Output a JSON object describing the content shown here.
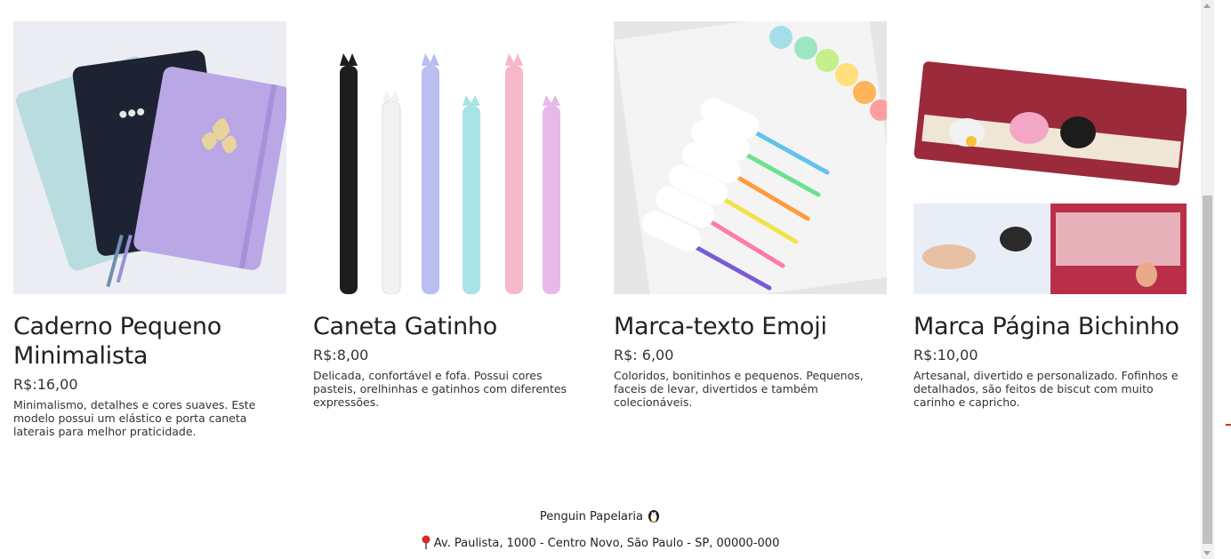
{
  "products": [
    {
      "name": "Caderno Pequeno Minimalista",
      "price": "R$:16,00",
      "description": "Minimalismo, detalhes e cores suaves. Este modelo possui um elástico e porta caneta laterais para melhor praticidade.",
      "image": "notebooks-image"
    },
    {
      "name": "Caneta Gatinho",
      "price": "R$:8,00",
      "description": "Delicada, confortável e fofa. Possui cores pasteis, orelhinhas e gatinhos com diferentes expressões.",
      "image": "cat-pens-image"
    },
    {
      "name": "Marca-texto Emoji",
      "price": "R$: 6,00",
      "description": "Coloridos, bonitinhos e pequenos. Pequenos, faceis de levar, divertidos e também colecionáveis.",
      "image": "highlighters-image"
    },
    {
      "name": "Marca Página Bichinho",
      "price": "R$:10,00",
      "description": "Artesanal, divertido e personalizado. Fofinhos e detalhados, são feitos de biscut com muito carinho e capricho.",
      "image": "bookmark-image"
    }
  ],
  "footer": {
    "brand": "Penguin Papelaria",
    "brand_icon": "penguin-icon",
    "address": "Av. Paulista, 1000 - Centro Novo, São Paulo - SP, 00000-000",
    "address_icon": "location-pin-icon"
  }
}
